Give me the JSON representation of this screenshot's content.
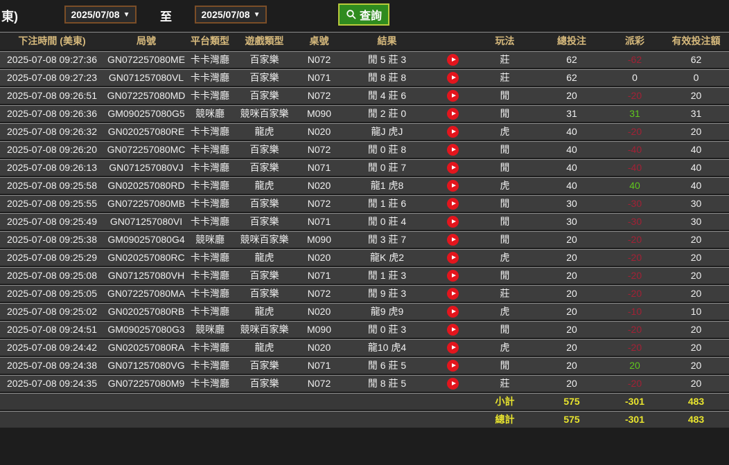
{
  "filters": {
    "cutoff_label": "東)",
    "date_from": "2025/07/08",
    "date_to": "2025/07/08",
    "to_label": "至",
    "query_label": "查詢"
  },
  "colors": {
    "header_text": "#d6b97c",
    "payout_negative": "#a32135",
    "payout_positive": "#5fc71d",
    "summary_text": "#e9e52e",
    "play_button": "#e3151d",
    "query_button_bg": "#2f8b1f",
    "query_button_border": "#b9cb3c",
    "date_border": "#7b4e27"
  },
  "table": {
    "columns": [
      "下注時間 (美東)",
      "局號",
      "平台類型",
      "遊戲類型",
      "桌號",
      "結果",
      "",
      "玩法",
      "總投注",
      "派彩",
      "有效投注額"
    ],
    "rows": [
      {
        "time": "2025-07-08 09:27:36",
        "game_no": "GN072257080ME",
        "platform": "卡卡灣廳",
        "game_type": "百家樂",
        "table_no": "N072",
        "result": "閒 5 莊 3",
        "play": "莊",
        "total_bet": "62",
        "payout": "-62",
        "payout_state": "neg",
        "valid_bet": "62"
      },
      {
        "time": "2025-07-08 09:27:23",
        "game_no": "GN071257080VL",
        "platform": "卡卡灣廳",
        "game_type": "百家樂",
        "table_no": "N071",
        "result": "閒 8 莊 8",
        "play": "莊",
        "total_bet": "62",
        "payout": "0",
        "payout_state": "neutral",
        "valid_bet": "0"
      },
      {
        "time": "2025-07-08 09:26:51",
        "game_no": "GN072257080MD",
        "platform": "卡卡灣廳",
        "game_type": "百家樂",
        "table_no": "N072",
        "result": "閒 4 莊 6",
        "play": "閒",
        "total_bet": "20",
        "payout": "-20",
        "payout_state": "neg",
        "valid_bet": "20"
      },
      {
        "time": "2025-07-08 09:26:36",
        "game_no": "GM090257080G5",
        "platform": "競咪廳",
        "game_type": "競咪百家樂",
        "table_no": "M090",
        "result": "閒 2 莊 0",
        "play": "閒",
        "total_bet": "31",
        "payout": "31",
        "payout_state": "pos",
        "valid_bet": "31"
      },
      {
        "time": "2025-07-08 09:26:32",
        "game_no": "GN020257080RE",
        "platform": "卡卡灣廳",
        "game_type": "龍虎",
        "table_no": "N020",
        "result": "龍J 虎J",
        "play": "虎",
        "total_bet": "40",
        "payout": "-20",
        "payout_state": "neg",
        "valid_bet": "20"
      },
      {
        "time": "2025-07-08 09:26:20",
        "game_no": "GN072257080MC",
        "platform": "卡卡灣廳",
        "game_type": "百家樂",
        "table_no": "N072",
        "result": "閒 0 莊 8",
        "play": "閒",
        "total_bet": "40",
        "payout": "-40",
        "payout_state": "neg",
        "valid_bet": "40"
      },
      {
        "time": "2025-07-08 09:26:13",
        "game_no": "GN071257080VJ",
        "platform": "卡卡灣廳",
        "game_type": "百家樂",
        "table_no": "N071",
        "result": "閒 0 莊 7",
        "play": "閒",
        "total_bet": "40",
        "payout": "-40",
        "payout_state": "neg",
        "valid_bet": "40"
      },
      {
        "time": "2025-07-08 09:25:58",
        "game_no": "GN020257080RD",
        "platform": "卡卡灣廳",
        "game_type": "龍虎",
        "table_no": "N020",
        "result": "龍1 虎8",
        "play": "虎",
        "total_bet": "40",
        "payout": "40",
        "payout_state": "pos",
        "valid_bet": "40"
      },
      {
        "time": "2025-07-08 09:25:55",
        "game_no": "GN072257080MB",
        "platform": "卡卡灣廳",
        "game_type": "百家樂",
        "table_no": "N072",
        "result": "閒 1 莊 6",
        "play": "閒",
        "total_bet": "30",
        "payout": "-30",
        "payout_state": "neg",
        "valid_bet": "30"
      },
      {
        "time": "2025-07-08 09:25:49",
        "game_no": "GN071257080VI",
        "platform": "卡卡灣廳",
        "game_type": "百家樂",
        "table_no": "N071",
        "result": "閒 0 莊 4",
        "play": "閒",
        "total_bet": "30",
        "payout": "-30",
        "payout_state": "neg",
        "valid_bet": "30"
      },
      {
        "time": "2025-07-08 09:25:38",
        "game_no": "GM090257080G4",
        "platform": "競咪廳",
        "game_type": "競咪百家樂",
        "table_no": "M090",
        "result": "閒 3 莊 7",
        "play": "閒",
        "total_bet": "20",
        "payout": "-20",
        "payout_state": "neg",
        "valid_bet": "20"
      },
      {
        "time": "2025-07-08 09:25:29",
        "game_no": "GN020257080RC",
        "platform": "卡卡灣廳",
        "game_type": "龍虎",
        "table_no": "N020",
        "result": "龍K 虎2",
        "play": "虎",
        "total_bet": "20",
        "payout": "-20",
        "payout_state": "neg",
        "valid_bet": "20"
      },
      {
        "time": "2025-07-08 09:25:08",
        "game_no": "GN071257080VH",
        "platform": "卡卡灣廳",
        "game_type": "百家樂",
        "table_no": "N071",
        "result": "閒 1 莊 3",
        "play": "閒",
        "total_bet": "20",
        "payout": "-20",
        "payout_state": "neg",
        "valid_bet": "20"
      },
      {
        "time": "2025-07-08 09:25:05",
        "game_no": "GN072257080MA",
        "platform": "卡卡灣廳",
        "game_type": "百家樂",
        "table_no": "N072",
        "result": "閒 9 莊 3",
        "play": "莊",
        "total_bet": "20",
        "payout": "-20",
        "payout_state": "neg",
        "valid_bet": "20"
      },
      {
        "time": "2025-07-08 09:25:02",
        "game_no": "GN020257080RB",
        "platform": "卡卡灣廳",
        "game_type": "龍虎",
        "table_no": "N020",
        "result": "龍9 虎9",
        "play": "虎",
        "total_bet": "20",
        "payout": "-10",
        "payout_state": "neg",
        "valid_bet": "10"
      },
      {
        "time": "2025-07-08 09:24:51",
        "game_no": "GM090257080G3",
        "platform": "競咪廳",
        "game_type": "競咪百家樂",
        "table_no": "M090",
        "result": "閒 0 莊 3",
        "play": "閒",
        "total_bet": "20",
        "payout": "-20",
        "payout_state": "neg",
        "valid_bet": "20"
      },
      {
        "time": "2025-07-08 09:24:42",
        "game_no": "GN020257080RA",
        "platform": "卡卡灣廳",
        "game_type": "龍虎",
        "table_no": "N020",
        "result": "龍10 虎4",
        "play": "虎",
        "total_bet": "20",
        "payout": "-20",
        "payout_state": "neg",
        "valid_bet": "20"
      },
      {
        "time": "2025-07-08 09:24:38",
        "game_no": "GN071257080VG",
        "platform": "卡卡灣廳",
        "game_type": "百家樂",
        "table_no": "N071",
        "result": "閒 6 莊 5",
        "play": "閒",
        "total_bet": "20",
        "payout": "20",
        "payout_state": "pos",
        "valid_bet": "20"
      },
      {
        "time": "2025-07-08 09:24:35",
        "game_no": "GN072257080M9",
        "platform": "卡卡灣廳",
        "game_type": "百家樂",
        "table_no": "N072",
        "result": "閒 8 莊 5",
        "play": "莊",
        "total_bet": "20",
        "payout": "-20",
        "payout_state": "neg",
        "valid_bet": "20"
      }
    ],
    "subtotal": {
      "label": "小計",
      "total_bet": "575",
      "payout": "-301",
      "valid_bet": "483"
    },
    "total": {
      "label": "總計",
      "total_bet": "575",
      "payout": "-301",
      "valid_bet": "483"
    }
  }
}
